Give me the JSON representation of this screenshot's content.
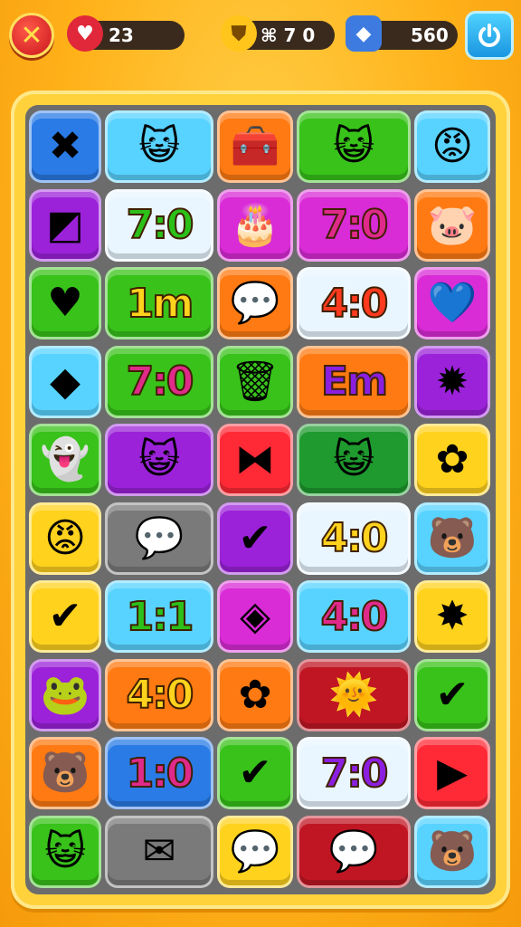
{
  "hud": {
    "lives": "23",
    "coins": "⌘ 7 0",
    "gems": "560"
  },
  "colors": {
    "blue": "#2a7be6",
    "lightblue": "#58d3ff",
    "orange": "#ff7a12",
    "green": "#38c21a",
    "red": "#ff2a36",
    "purple": "#9b22d9",
    "magenta": "#d92bd6",
    "white": "#eaf6ff",
    "yellow": "#ffd21e",
    "darkgreen": "#1e9a2e",
    "gray": "#7a7a7a",
    "darkred": "#c01623"
  },
  "rows": [
    [
      {
        "c": "blue",
        "g": "✖",
        "k": "x-icon"
      },
      {
        "c": "lightblue",
        "g": "😺",
        "k": "cat-face-icon"
      },
      {
        "c": "orange",
        "g": "🧰",
        "k": "chest-icon"
      },
      {
        "c": "green",
        "g": "😺",
        "k": "cat-face-icon"
      },
      {
        "c": "lightblue",
        "g": "😡",
        "k": "red-face-icon"
      }
    ],
    [
      {
        "c": "purple",
        "g": "◩",
        "k": "square-icon"
      },
      {
        "c": "white",
        "t": "7:0"
      },
      {
        "c": "magenta",
        "g": "🎂",
        "k": "cake-face-icon"
      },
      {
        "c": "magenta",
        "t": "7:0"
      },
      {
        "c": "orange",
        "g": "🐷",
        "k": "pig-face-icon"
      }
    ],
    [
      {
        "c": "green",
        "g": "♥",
        "k": "heart-icon"
      },
      {
        "c": "green",
        "t": "1m"
      },
      {
        "c": "orange",
        "g": "💬",
        "k": "speech-bubble-icon"
      },
      {
        "c": "white",
        "t": "4:0"
      },
      {
        "c": "magenta",
        "g": "💙",
        "k": "heart-icon"
      }
    ],
    [
      {
        "c": "lightblue",
        "g": "◆",
        "k": "diamond-icon"
      },
      {
        "c": "green",
        "t": "7:0"
      },
      {
        "c": "green",
        "g": "🗑",
        "k": "bin-icon"
      },
      {
        "c": "orange",
        "t": "Em"
      },
      {
        "c": "purple",
        "g": "✹",
        "k": "sun-icon"
      }
    ],
    [
      {
        "c": "green",
        "g": "👻",
        "k": "ghost-icon"
      },
      {
        "c": "purple",
        "g": "😺",
        "k": "cat-face-icon"
      },
      {
        "c": "red",
        "g": "⧓",
        "k": "bowtie-icon"
      },
      {
        "c": "darkgreen",
        "g": "😺",
        "k": "cat-face-icon"
      },
      {
        "c": "yellow",
        "g": "✿",
        "k": "flower-icon"
      }
    ],
    [
      {
        "c": "yellow",
        "g": "😡",
        "k": "red-face-icon"
      },
      {
        "c": "gray",
        "g": "💬",
        "k": "speech-bubble-icon"
      },
      {
        "c": "purple",
        "g": "✔",
        "k": "check-icon"
      },
      {
        "c": "white",
        "t": "4:0"
      },
      {
        "c": "lightblue",
        "g": "🐻",
        "k": "bear-face-icon"
      }
    ],
    [
      {
        "c": "yellow",
        "g": "✔",
        "k": "check-icon"
      },
      {
        "c": "lightblue",
        "t": "1:1"
      },
      {
        "c": "magenta",
        "g": "◈",
        "k": "gem-icon"
      },
      {
        "c": "lightblue",
        "t": "4:0"
      },
      {
        "c": "yellow",
        "g": "✸",
        "k": "star-burst-icon"
      }
    ],
    [
      {
        "c": "purple",
        "g": "🐸",
        "k": "frog-face-icon"
      },
      {
        "c": "orange",
        "t": "4:0"
      },
      {
        "c": "orange",
        "g": "✿",
        "k": "flower-icon"
      },
      {
        "c": "darkred",
        "g": "🌞",
        "k": "sun-face-icon"
      },
      {
        "c": "green",
        "g": "✔",
        "k": "check-icon"
      }
    ],
    [
      {
        "c": "orange",
        "g": "🐻",
        "k": "bear-face-icon"
      },
      {
        "c": "blue",
        "t": "1:0"
      },
      {
        "c": "green",
        "g": "✔",
        "k": "check-icon"
      },
      {
        "c": "white",
        "t": "7:0"
      },
      {
        "c": "red",
        "g": "▶",
        "k": "play-icon"
      }
    ],
    [
      {
        "c": "green",
        "g": "😺",
        "k": "cat-face-icon"
      },
      {
        "c": "gray",
        "g": "✉",
        "k": "mail-icon"
      },
      {
        "c": "yellow",
        "g": "💬",
        "k": "speech-bubble-icon"
      },
      {
        "c": "darkred",
        "g": "💬",
        "k": "speech-bubble-icon"
      },
      {
        "c": "lightblue",
        "g": "🐻",
        "k": "bear-face-icon"
      }
    ]
  ]
}
